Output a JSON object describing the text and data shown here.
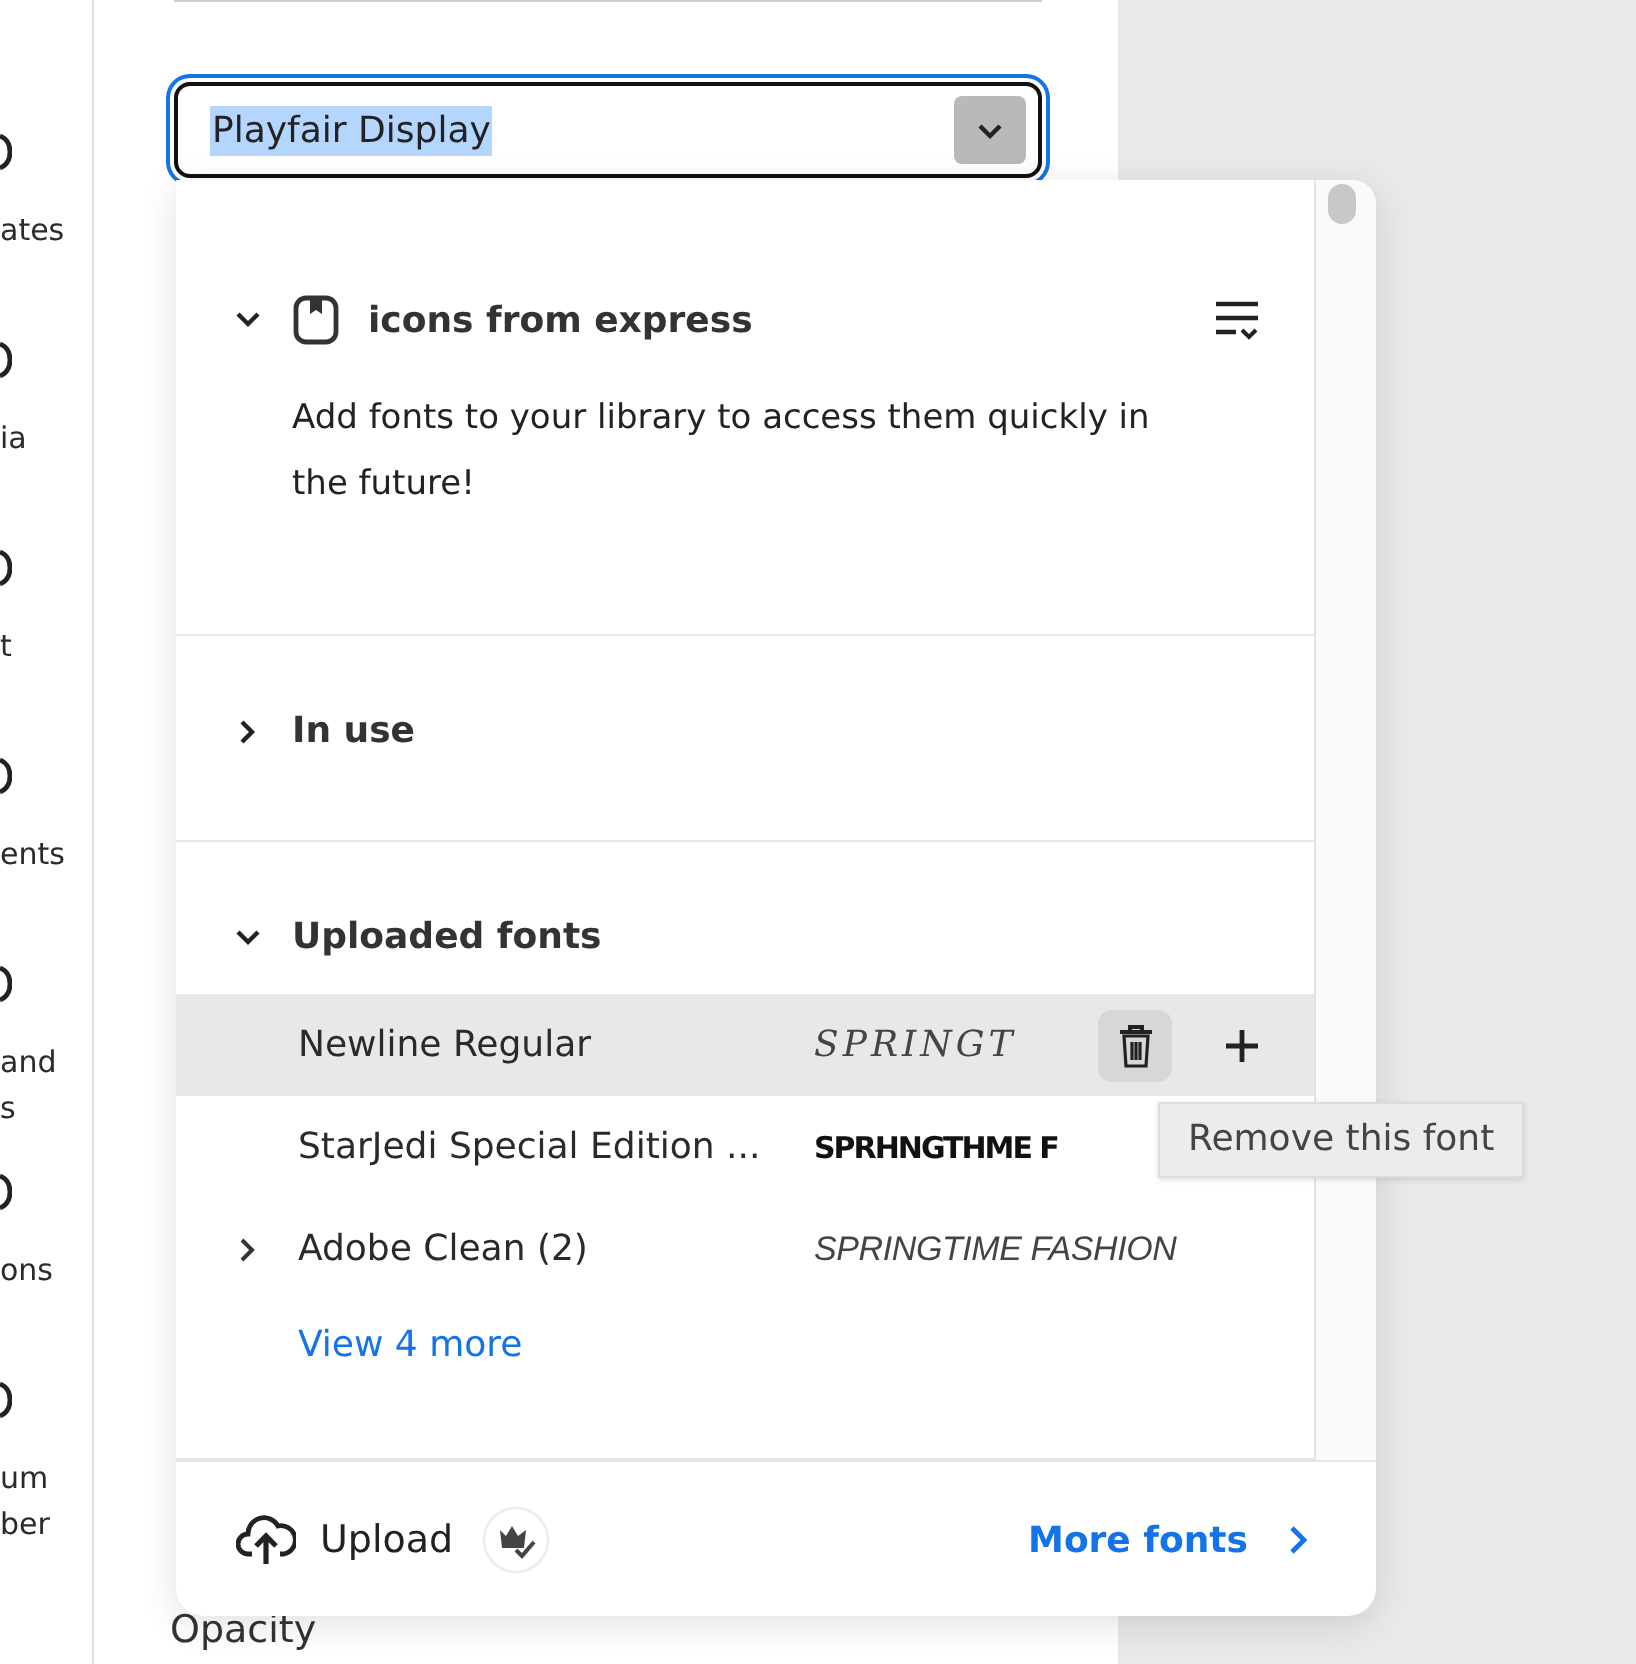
{
  "sidebar": {
    "items": [
      {
        "lines": [
          "ates"
        ]
      },
      {
        "lines": [
          "ia"
        ]
      },
      {
        "lines": [
          "t"
        ]
      },
      {
        "lines": [
          "ents"
        ]
      },
      {
        "lines": [
          "and",
          "s"
        ]
      },
      {
        "lines": [
          "ons"
        ]
      },
      {
        "lines": [
          "um",
          "ber"
        ]
      }
    ]
  },
  "font_field": {
    "value": "Playfair Display",
    "text_selected": true,
    "focused": true
  },
  "opacity_label": "Opacity",
  "font_menu": {
    "library": {
      "title": "icons from express",
      "expanded": true,
      "description": "Add fonts to your library to access them quickly in the future!"
    },
    "in_use": {
      "title": "In use",
      "expanded": false
    },
    "uploaded": {
      "title": "Uploaded fonts",
      "expanded": true,
      "rows": [
        {
          "name": "Newline Regular",
          "sample": "SPRINGT",
          "kind": "script",
          "hovered": true,
          "expandable": false
        },
        {
          "name": "StarJedi Special Edition ...",
          "sample": "SPRHNGTHME F",
          "kind": "stencil",
          "hovered": false,
          "expandable": false
        },
        {
          "name": "Adobe Clean (2)",
          "sample": "SPRINGTIME FASHION",
          "kind": "italic",
          "hovered": false,
          "expandable": true
        }
      ],
      "view_more": "View 4 more"
    },
    "upload": "Upload",
    "more_fonts": "More fonts",
    "tooltip": "Remove this font"
  }
}
